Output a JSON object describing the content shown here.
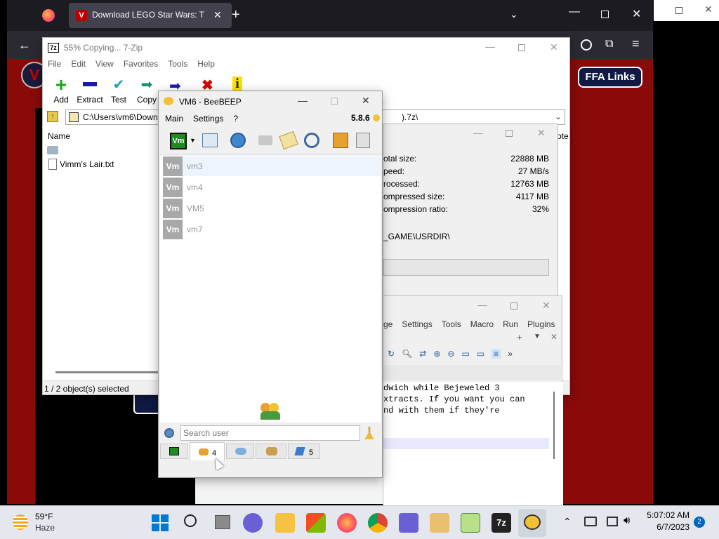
{
  "browser": {
    "tab_title": "Download LEGO Star Wars: The",
    "ffa_links": "FFA Links"
  },
  "zip": {
    "title": "55% Copying... 7-Zip",
    "menu": [
      "File",
      "Edit",
      "View",
      "Favorites",
      "Tools",
      "Help"
    ],
    "toolbar": {
      "add": "Add",
      "extract": "Extract",
      "test": "Test",
      "copy": "Copy"
    },
    "path": "C:\\Users\\vm6\\Down",
    "path_tail": ").7z\\",
    "column_name": "Name",
    "files": [
      "",
      "Vimm's Lair.txt"
    ],
    "status": "1 / 2 object(s) selected",
    "right_edge_text": "ote"
  },
  "copy_dialog": {
    "labels": [
      "otal size:",
      "peed:",
      "rocessed:",
      "ompressed size:",
      "ompression ratio:"
    ],
    "values": [
      "22888 MB",
      "27 MB/s",
      "12763 MB",
      "4117 MB",
      "32%"
    ],
    "path": "_GAME\\USRDIR\\"
  },
  "npp": {
    "menu": [
      "ge",
      "Settings",
      "Tools",
      "Macro",
      "Run",
      "Plugins"
    ],
    "lines": [
      "dwich while Bejeweled 3",
      "xtracts. If you want you can",
      "nd with them if they're"
    ]
  },
  "beebeep": {
    "title": "VM6 - BeeBEEP",
    "menu": [
      "Main",
      "Settings",
      "?"
    ],
    "version": "5.8.6",
    "avatar_label": "Vm",
    "users": [
      "vm3",
      "vm4",
      "VM5",
      "vm7"
    ],
    "search_placeholder": "Search user",
    "tab_users_count": "4",
    "tab_groups_count": "5"
  },
  "taskbar": {
    "weather_temp": "59°F",
    "weather_desc": "Haze",
    "time": "5:07:02 AM",
    "date": "6/7/2023",
    "notifications": "2",
    "app_7z_label": "7z"
  },
  "colors": {
    "brand_red": "#8a0a0a",
    "beebeep_avatar": "#a8a8a8",
    "accent_blue": "#0067c0"
  }
}
